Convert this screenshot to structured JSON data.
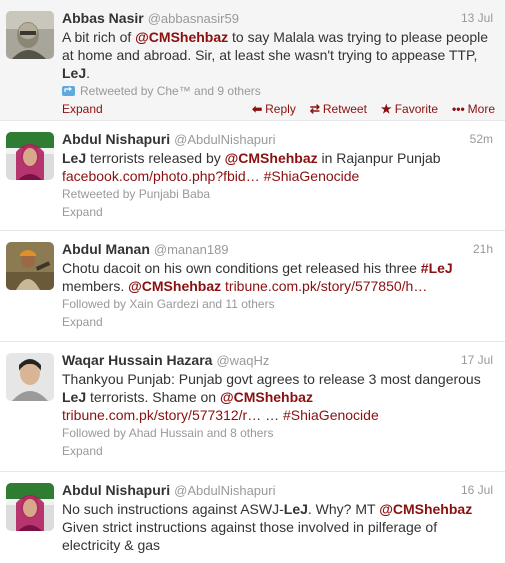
{
  "tweets": [
    {
      "name": "Abbas Nasir",
      "handle": "@abbasnasir59",
      "time": "13 Jul",
      "segments": [
        {
          "t": "A bit rich of ",
          "k": "p"
        },
        {
          "t": "@CMShehbaz",
          "k": "m"
        },
        {
          "t": " to say Malala was trying to please people at home and abroad. Sir, at least she wasn't trying to appease TTP, ",
          "k": "p"
        },
        {
          "t": "LeJ",
          "k": "b"
        },
        {
          "t": ".",
          "k": "p"
        }
      ],
      "meta": "Retweeted by Che™ and 9 others",
      "expand": "Expand",
      "actions": {
        "reply": "Reply",
        "retweet": "Retweet",
        "favorite": "Favorite",
        "more": "More"
      }
    },
    {
      "name": "Abdul Nishapuri",
      "handle": "@AbdulNishapuri",
      "time": "52m",
      "segments": [
        {
          "t": "LeJ",
          "k": "b"
        },
        {
          "t": " terrorists released by ",
          "k": "p"
        },
        {
          "t": "@CMShehbaz",
          "k": "m"
        },
        {
          "t": " in Rajanpur Punjab ",
          "k": "p"
        },
        {
          "t": "facebook.com/photo.php?fbid…",
          "k": "l"
        },
        {
          "t": " ",
          "k": "p"
        },
        {
          "t": "#ShiaGenocide",
          "k": "l"
        }
      ],
      "meta": "Retweeted by Punjabi Baba",
      "expand": "Expand"
    },
    {
      "name": "Abdul Manan",
      "handle": "@manan189",
      "time": "21h",
      "segments": [
        {
          "t": "Chotu dacoit on his own conditions get released his three ",
          "k": "p"
        },
        {
          "t": "#LeJ",
          "k": "m"
        },
        {
          "t": " members. ",
          "k": "p"
        },
        {
          "t": "@CMShehbaz",
          "k": "m"
        },
        {
          "t": " ",
          "k": "p"
        },
        {
          "t": "tribune.com.pk/story/577850/h…",
          "k": "l"
        }
      ],
      "meta": "Followed by Xain Gardezi and 11 others",
      "expand": "Expand"
    },
    {
      "name": "Waqar Hussain Hazara",
      "handle": "@waqHz",
      "time": "17 Jul",
      "segments": [
        {
          "t": "Thankyou Punjab: Punjab govt agrees to release 3 most dangerous ",
          "k": "p"
        },
        {
          "t": "LeJ",
          "k": "b"
        },
        {
          "t": " terrorists. Shame on ",
          "k": "p"
        },
        {
          "t": "@CMShehbaz",
          "k": "m"
        },
        {
          "t": " ",
          "k": "p"
        },
        {
          "t": "tribune.com.pk/story/577312/r…",
          "k": "l"
        },
        {
          "t": " … ",
          "k": "p"
        },
        {
          "t": "#ShiaGenocide",
          "k": "l"
        }
      ],
      "meta": "Followed by Ahad Hussain and 8 others",
      "expand": "Expand"
    },
    {
      "name": "Abdul Nishapuri",
      "handle": "@AbdulNishapuri",
      "time": "16 Jul",
      "segments": [
        {
          "t": "No such instructions against ASWJ-",
          "k": "p"
        },
        {
          "t": "LeJ",
          "k": "b"
        },
        {
          "t": ". Why? MT ",
          "k": "p"
        },
        {
          "t": "@CMShehbaz",
          "k": "m"
        },
        {
          "t": " Given strict instructions against those involved in pilferage of electricity & gas",
          "k": "p"
        }
      ]
    }
  ],
  "colors": {
    "link": "#8a1010",
    "muted": "#999999",
    "text": "#333333",
    "highlight_bg": "#f5f5f5"
  },
  "icons": {
    "retweet_badge": "retweet-badge-icon",
    "reply": "reply-arrow-icon",
    "retweet": "retweet-icon",
    "favorite": "star-icon",
    "more": "ellipsis-icon"
  }
}
